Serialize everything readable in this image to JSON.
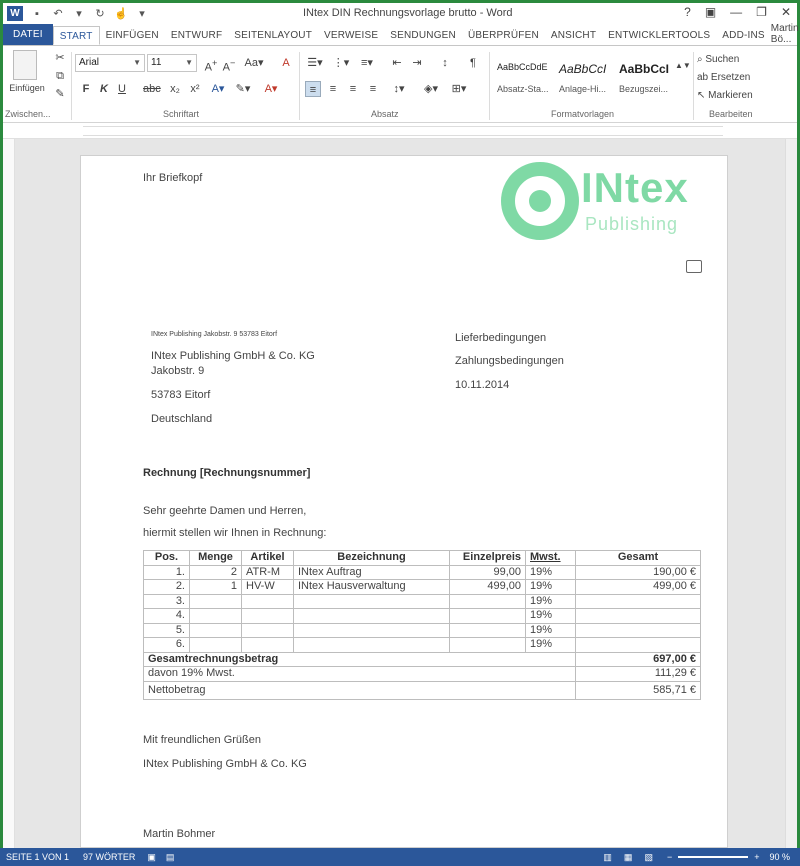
{
  "window": {
    "title": "INtex DIN Rechnungsvorlage brutto - Word",
    "help": "?",
    "controls": [
      "▣",
      "—",
      "❐",
      "✕"
    ]
  },
  "tabs": [
    "DATEI",
    "START",
    "EINFÜGEN",
    "ENTWURF",
    "SEITENLAYOUT",
    "VERWEISE",
    "SENDUNGEN",
    "ÜBERPRÜFEN",
    "ANSICHT",
    "ENTWICKLERTOOLS",
    "ADD-INS"
  ],
  "user": {
    "name": "Martin Bö..."
  },
  "ribbon": {
    "paste_label": "Einfügen",
    "font_name": "Arial",
    "font_size": "11",
    "groups": {
      "clipboard": "Zwischen...",
      "font": "Schriftart",
      "paragraph": "Absatz",
      "styles": "Formatvorlagen",
      "editing": "Bearbeiten"
    },
    "styles": [
      {
        "sample": "AaBbCcDdE",
        "name": "Absatz-Sta..."
      },
      {
        "sample": "AaBbCcI",
        "name": "Anlage-Hi..."
      },
      {
        "sample": "AaBbCcI",
        "name": "Bezugszei..."
      }
    ],
    "editing": {
      "search": "Suchen",
      "replace": "Ersetzen",
      "select": "Markieren"
    }
  },
  "document": {
    "letterhead": "Ihr Briefkopf",
    "logo": {
      "word": "INtex",
      "sub": "Publishing"
    },
    "sender_line": "INtex Publishing   Jakobstr. 9   53783 Eitorf",
    "recipient": [
      "INtex Publishing GmbH & Co. KG",
      "Jakobstr. 9",
      "53783 Eitorf",
      "Deutschland"
    ],
    "info": [
      "Lieferbedingungen",
      "Zahlungsbedingungen",
      "10.11.2014"
    ],
    "subject": "Rechnung [Rechnungsnummer]",
    "salutation": "Sehr geehrte Damen und Herren,",
    "intro": "hiermit stellen wir Ihnen in Rechnung:",
    "table": {
      "headers": [
        "Pos.",
        "Menge",
        "Artikel",
        "Bezeichnung",
        "Einzelpreis",
        "Mwst.",
        "Gesamt"
      ],
      "rows": [
        [
          "1.",
          "2",
          "ATR-M",
          "INtex Auftrag",
          "99,00",
          "19%",
          "190,00 €"
        ],
        [
          "2.",
          "1",
          "HV-W",
          "INtex Hausverwaltung",
          "499,00",
          "19%",
          "499,00 €"
        ],
        [
          "3.",
          "",
          "",
          "",
          "",
          "19%",
          ""
        ],
        [
          "4.",
          "",
          "",
          "",
          "",
          "19%",
          ""
        ],
        [
          "5.",
          "",
          "",
          "",
          "",
          "19%",
          ""
        ],
        [
          "6.",
          "",
          "",
          "",
          "",
          "19%",
          ""
        ]
      ],
      "total_label": "Gesamtrechnungsbetrag",
      "total_value": "697,00 €",
      "vat_label": "davon 19% Mwst.",
      "vat_value": "111,29 €",
      "net_label": "Nettobetrag",
      "net_value": "585,71 €"
    },
    "closing": "Mit freundlichen Grüßen",
    "closing_company": "INtex Publishing GmbH & Co. KG",
    "signature": "Martin Bohmer"
  },
  "status": {
    "page": "SEITE 1 VON 1",
    "words": "97 WÖRTER",
    "zoom": "90 %"
  },
  "colors": {
    "accent": "#2b579a",
    "logo": "#7fd9a5",
    "frame": "#2b8a3e"
  }
}
